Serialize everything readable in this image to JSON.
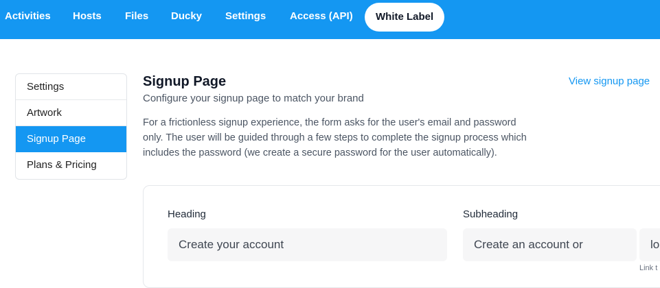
{
  "topnav": {
    "tabs": [
      {
        "label": "Activities"
      },
      {
        "label": "Hosts"
      },
      {
        "label": "Files"
      },
      {
        "label": "Ducky"
      },
      {
        "label": "Settings"
      },
      {
        "label": "Access (API)"
      },
      {
        "label": "White Label",
        "active": true
      }
    ]
  },
  "sidebar": {
    "items": [
      {
        "label": "Settings"
      },
      {
        "label": "Artwork"
      },
      {
        "label": "Signup Page",
        "active": true
      },
      {
        "label": "Plans & Pricing"
      }
    ]
  },
  "main": {
    "title": "Signup Page",
    "view_link": "View signup page",
    "subtitle": "Configure your signup page to match your brand",
    "description_lines": [
      "For a frictionless signup experience, the form asks for the user's email and password",
      "only. The user will be guided through a few steps to complete the signup process which",
      "includes the password (we create a secure password for the user automatically)."
    ]
  },
  "form": {
    "heading_label": "Heading",
    "heading_value": "Create your account",
    "subheading_label": "Subheading",
    "subheading_value": "Create an account or",
    "link_value": "lo",
    "link_hint": "Link t"
  },
  "colors": {
    "accent": "#1497f2"
  }
}
